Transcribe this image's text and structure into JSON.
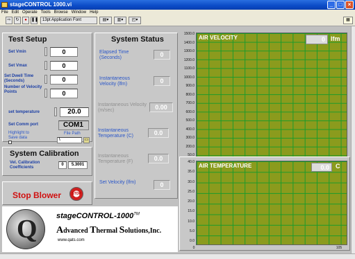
{
  "window": {
    "title": "stageCONTROL 1000.vi"
  },
  "menu": [
    "File",
    "Edit",
    "Operate",
    "Tools",
    "Browse",
    "Window",
    "Help"
  ],
  "toolbar": {
    "font": "13pt Application Font"
  },
  "test_setup": {
    "title": "Test Setup",
    "vmin_label": "Set Vmin",
    "vmin": "0",
    "vmax_label": "Set Vmax",
    "vmax": "0",
    "dwell_label": "Set Dwell Time (Seconds)",
    "dwell": "0",
    "points_label": "Number of Velocity Points",
    "points": "0",
    "temp_label": "set temperature",
    "temp": "20.0",
    "comm_label": "Set Comm port",
    "comm": "COM1",
    "highlight_label": "Highlight to Save data",
    "filepath_label": "File Path",
    "filepath": "\\"
  },
  "system_status": {
    "title": "System Status",
    "elapsed_label": "Elapsed Time (Seconds)",
    "elapsed": "0",
    "inst_vel_label": "Instantaneous Velocity (lfm)",
    "inst_vel": "0",
    "inst_vel_ms_label": "Instantaneous Velocity (m/sec)",
    "inst_vel_ms": "0.00",
    "inst_temp_c_label": "Instantaneous Temperature (C)",
    "inst_temp_c": "0.0",
    "inst_temp_f_label": "Instantaneous Temperature (F)",
    "inst_temp_f": "0.0",
    "set_vel_label": "Set Velocity (lfm)",
    "set_vel": "0"
  },
  "calibration": {
    "title": "System Calibration",
    "label": "Vel. Calibration Coefficients",
    "index": "0",
    "value": "5.3001"
  },
  "stop": {
    "label": "Stop Blower",
    "button": "STOP"
  },
  "logo": {
    "product": "stageCONTROL-1000",
    "tm": "TM",
    "company_a": "A",
    "company_b": "dvanced ",
    "company_c": "T",
    "company_d": "hermal ",
    "company_e": "S",
    "company_f": "olutions,Inc.",
    "url": "www.qats.com"
  },
  "velocity_chart": {
    "title": "AIR VELOCITY",
    "value": "0",
    "unit": "lfm",
    "yticks": [
      "1500.0",
      "1400.0",
      "1300.0",
      "1200.0",
      "1100.0",
      "1000.0",
      "900.0",
      "800.0",
      "700.0",
      "600.0",
      "500.0",
      "400.0",
      "300.0",
      "200.0",
      "50.0"
    ],
    "xmin": "0",
    "xmax": "105"
  },
  "temp_chart": {
    "title": "AIR TEMPERATURE",
    "value": "0.0",
    "unit": "C",
    "yticks": [
      "40.0",
      "35.0",
      "30.0",
      "25.0",
      "20.0",
      "15.0",
      "10.0",
      "5.0",
      "0.0"
    ],
    "xmin": "0",
    "xmax": "105"
  }
}
